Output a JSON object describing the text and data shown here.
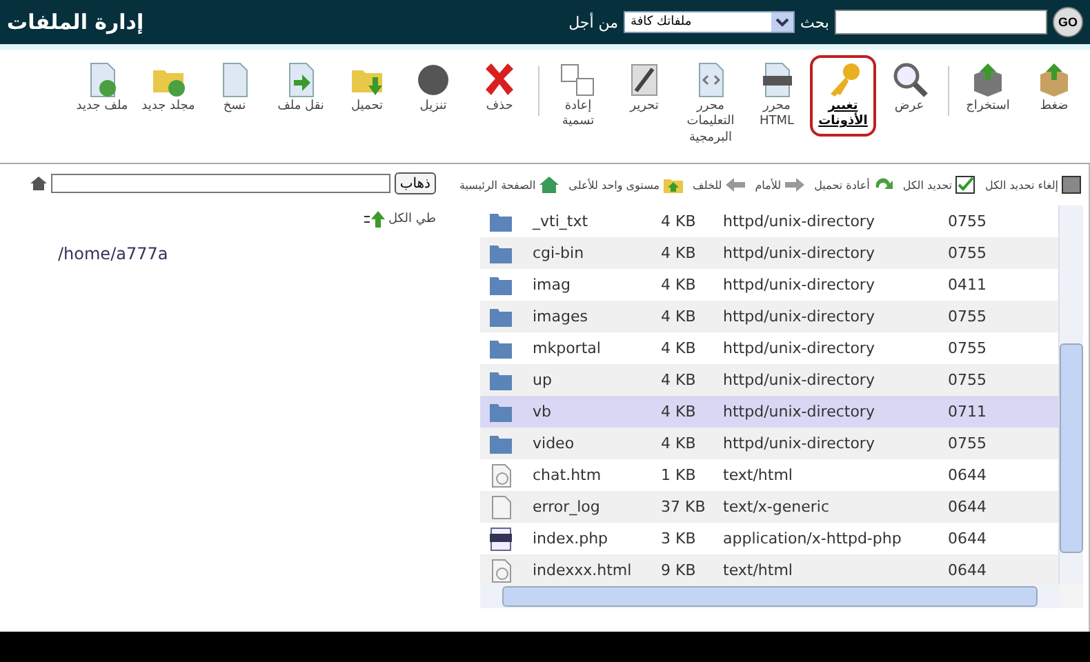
{
  "header": {
    "title": "إدارة الملفات",
    "search_button": "GO",
    "search_label": "بحث",
    "scope": "ملفاتك كافة",
    "for_label": "من أجل"
  },
  "toolbar": [
    {
      "kind": "compress",
      "label": "ضغط",
      "selected": false
    },
    {
      "kind": "extract",
      "label": "استخراج",
      "selected": false
    },
    {
      "kind": "separator"
    },
    {
      "kind": "view",
      "label": "عرض",
      "selected": false
    },
    {
      "kind": "permissions",
      "label": "تغيير الأذونات",
      "selected": true
    },
    {
      "kind": "html",
      "label": "محرر HTML",
      "selected": false
    },
    {
      "kind": "code",
      "label": "محرر التعليمات البرمجية",
      "selected": false
    },
    {
      "kind": "edit",
      "label": "تحرير",
      "selected": false
    },
    {
      "kind": "rename",
      "label": "إعادة تسمية",
      "selected": false
    },
    {
      "kind": "separator"
    },
    {
      "kind": "delete",
      "label": "حذف",
      "selected": false
    },
    {
      "kind": "download",
      "label": "تنزيل",
      "selected": false
    },
    {
      "kind": "upload",
      "label": "تحميل",
      "selected": false
    },
    {
      "kind": "move",
      "label": "نقل ملف",
      "selected": false
    },
    {
      "kind": "copy",
      "label": "نسخ",
      "selected": false
    },
    {
      "kind": "newfolder",
      "label": "مجلد جديد",
      "selected": false
    },
    {
      "kind": "newfile",
      "label": "ملف جديد",
      "selected": false
    }
  ],
  "nav": [
    {
      "kind": "unselect",
      "label": "إلغاء تحديد الكل"
    },
    {
      "kind": "selectall",
      "label": "تحديد الكل"
    },
    {
      "kind": "reload",
      "label": "أعادة تحميل"
    },
    {
      "kind": "forward",
      "label": "للأمام"
    },
    {
      "kind": "back",
      "label": "للخلف"
    },
    {
      "kind": "up",
      "label": "مستوى واحد للأعلى"
    },
    {
      "kind": "home",
      "label": "الصفحة الرئيسية"
    }
  ],
  "tree": {
    "go_button": "ذهاب",
    "collapse": "طي الكل",
    "path": "/home/a777a"
  },
  "files": [
    {
      "kind": "folder",
      "name": "_vti_txt",
      "size": "4 KB",
      "type": "httpd/unix-directory",
      "perms": "0755",
      "selected": false
    },
    {
      "kind": "folder",
      "name": "cgi-bin",
      "size": "4 KB",
      "type": "httpd/unix-directory",
      "perms": "0755",
      "selected": false
    },
    {
      "kind": "folder",
      "name": "imag",
      "size": "4 KB",
      "type": "httpd/unix-directory",
      "perms": "0411",
      "selected": false
    },
    {
      "kind": "folder",
      "name": "images",
      "size": "4 KB",
      "type": "httpd/unix-directory",
      "perms": "0755",
      "selected": false
    },
    {
      "kind": "folder",
      "name": "mkportal",
      "size": "4 KB",
      "type": "httpd/unix-directory",
      "perms": "0755",
      "selected": false
    },
    {
      "kind": "folder",
      "name": "up",
      "size": "4 KB",
      "type": "httpd/unix-directory",
      "perms": "0755",
      "selected": false
    },
    {
      "kind": "folder",
      "name": "vb",
      "size": "4 KB",
      "type": "httpd/unix-directory",
      "perms": "0711",
      "selected": true
    },
    {
      "kind": "folder",
      "name": "video",
      "size": "4 KB",
      "type": "httpd/unix-directory",
      "perms": "0755",
      "selected": false
    },
    {
      "kind": "html",
      "name": "chat.htm",
      "size": "1 KB",
      "type": "text/html",
      "perms": "0644",
      "selected": false
    },
    {
      "kind": "text",
      "name": "error_log",
      "size": "37 KB",
      "type": "text/x-generic",
      "perms": "0644",
      "selected": false
    },
    {
      "kind": "php",
      "name": "index.php",
      "size": "3 KB",
      "type": "application/x-httpd-php",
      "perms": "0644",
      "selected": false
    },
    {
      "kind": "html",
      "name": "indexxx.html",
      "size": "9 KB",
      "type": "text/html",
      "perms": "0644",
      "selected": false
    }
  ]
}
